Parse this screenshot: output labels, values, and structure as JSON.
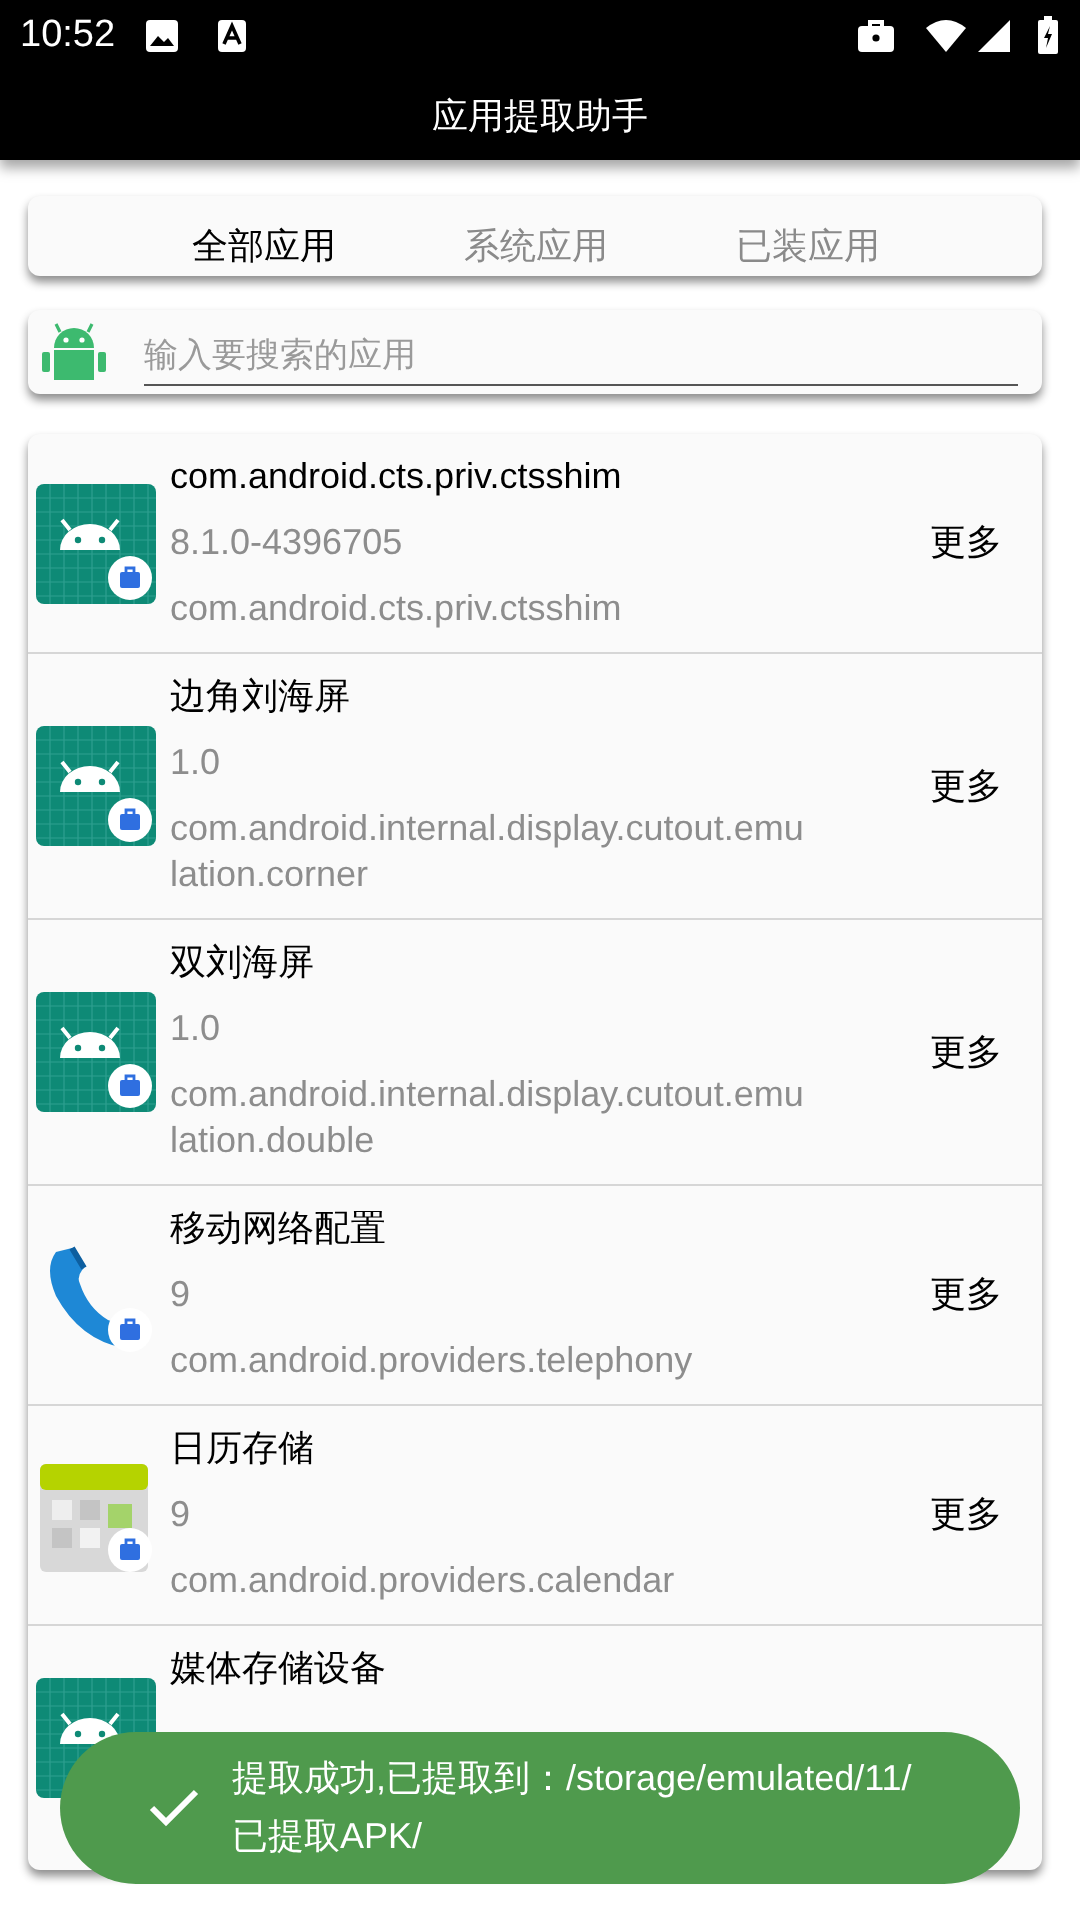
{
  "status_bar": {
    "time": "10:52"
  },
  "app_bar": {
    "title": "应用提取助手"
  },
  "tabs": [
    {
      "label": "全部应用",
      "selected": true
    },
    {
      "label": "系统应用",
      "selected": false
    },
    {
      "label": "已装应用",
      "selected": false
    }
  ],
  "search": {
    "placeholder": "输入要搜索的应用"
  },
  "apps": [
    {
      "kind": "android",
      "name": "com.android.cts.priv.ctsshim",
      "version": "8.1.0-4396705",
      "package": "com.android.cts.priv.ctsshim",
      "action": "更多"
    },
    {
      "kind": "android",
      "name": "边角刘海屏",
      "version": "1.0",
      "package": "com.android.internal.display.cutout.emulation.corner",
      "action": "更多"
    },
    {
      "kind": "android",
      "name": "双刘海屏",
      "version": "1.0",
      "package": "com.android.internal.display.cutout.emulation.double",
      "action": "更多"
    },
    {
      "kind": "phone",
      "name": "移动网络配置",
      "version": "9",
      "package": "com.android.providers.telephony",
      "action": "更多"
    },
    {
      "kind": "calendar",
      "name": "日历存储",
      "version": "9",
      "package": "com.android.providers.calendar",
      "action": "更多"
    },
    {
      "kind": "android",
      "name": "媒体存储设备"
    }
  ],
  "toast": {
    "message": "提取成功,已提取到：/storage/emulated/11/已提取APK/"
  }
}
